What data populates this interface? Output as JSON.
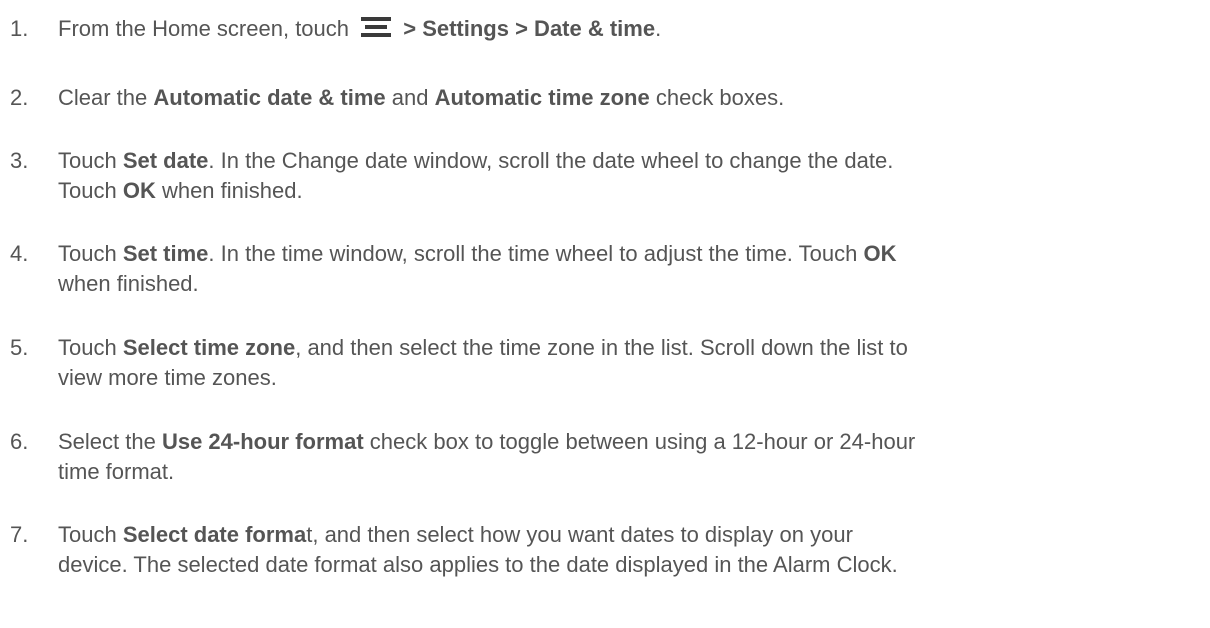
{
  "steps": [
    {
      "num": "1.",
      "parts": {
        "a": "From the Home screen, touch ",
        "b": " > Settings > Date & time",
        "c": "."
      },
      "icon": "menu-icon"
    },
    {
      "num": "2.",
      "parts": {
        "a": "Clear the ",
        "b": "Automatic date & time",
        "c": " and ",
        "d": "Automatic time zone",
        "e": " check boxes."
      }
    },
    {
      "num": "3.",
      "parts": {
        "a": "Touch ",
        "b": "Set date",
        "c": ". In the Change date window, scroll the date wheel to change the date.",
        "d": "Touch ",
        "e": "OK",
        "f": " when finished."
      }
    },
    {
      "num": "4.",
      "parts": {
        "a": "Touch ",
        "b": "Set time",
        "c": ". In the time window, scroll the time wheel to adjust the time. Touch ",
        "d": "OK",
        "e": "when finished."
      }
    },
    {
      "num": "5.",
      "parts": {
        "a": "Touch ",
        "b": "Select time zone",
        "c": ", and then select the time zone in the list. Scroll down the list to",
        "d": "view more time zones."
      }
    },
    {
      "num": "6.",
      "parts": {
        "a": "Select the ",
        "b": "Use 24-hour format",
        "c": " check box to toggle between using a 12-hour or 24-hour",
        "d": "time format."
      }
    },
    {
      "num": "7.",
      "parts": {
        "a": "Touch ",
        "b": "Select date forma",
        "c": "t, and then select how you want dates to display on your",
        "d": "device. The selected date format also applies to the date displayed in the Alarm Clock."
      }
    }
  ]
}
